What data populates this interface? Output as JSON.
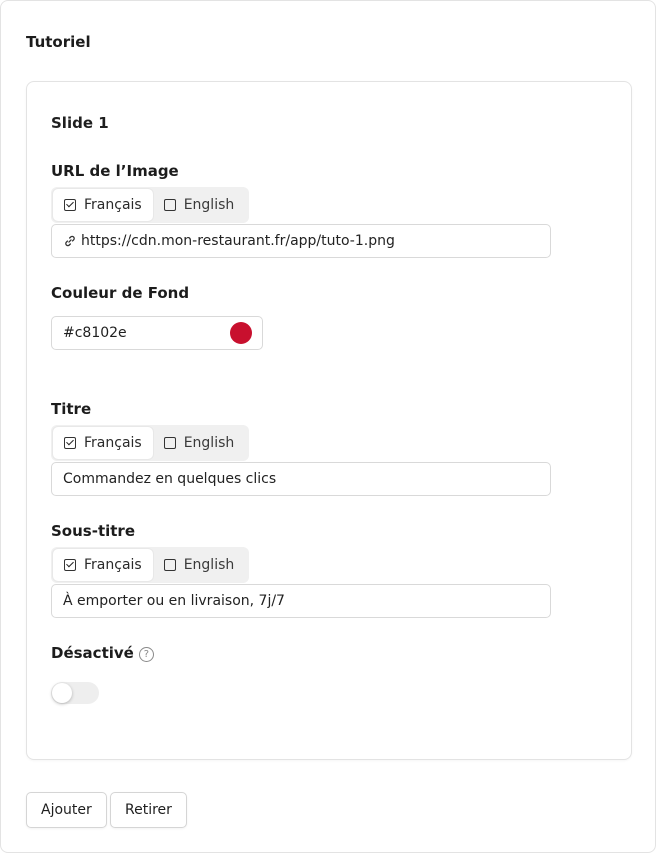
{
  "page_title": "Tutoriel",
  "slide": {
    "title": "Slide 1",
    "image_url": {
      "label": "URL de l’Image",
      "lang_fr": "Français",
      "lang_en": "English",
      "value": "https://cdn.mon-restaurant.fr/app/tuto-1.png"
    },
    "background_color": {
      "label": "Couleur de Fond",
      "value": "#c8102e",
      "swatch": "#c8102e"
    },
    "title_field": {
      "label": "Titre",
      "lang_fr": "Français",
      "lang_en": "English",
      "value": "Commandez en quelques clics"
    },
    "subtitle_field": {
      "label": "Sous-titre",
      "lang_fr": "Français",
      "lang_en": "English",
      "value": "À emporter ou en livraison, 7j/7"
    },
    "disabled": {
      "label": "Désactivé",
      "help_icon": "?",
      "state": "off"
    }
  },
  "actions": {
    "add_label": "Ajouter",
    "remove_label": "Retirer"
  }
}
